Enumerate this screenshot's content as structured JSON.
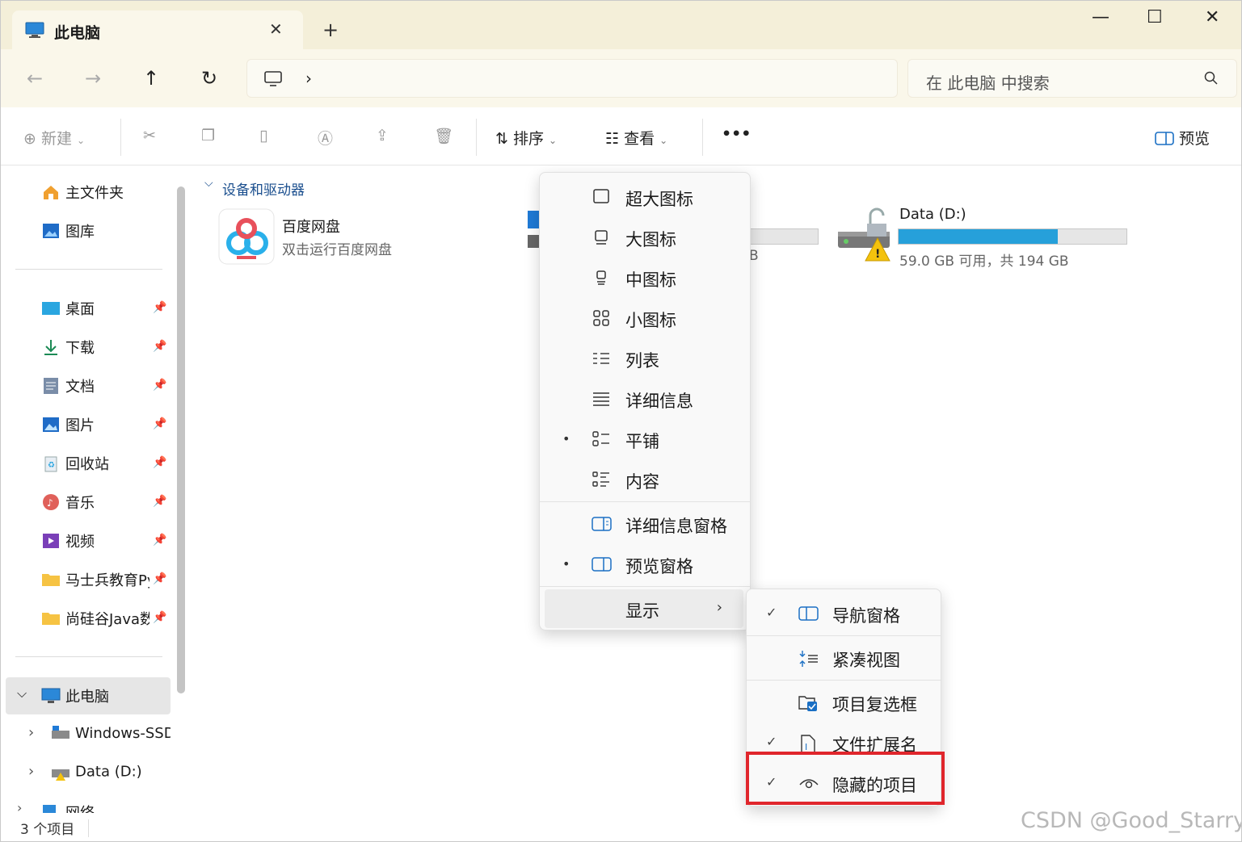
{
  "window": {
    "tab_title": "此电脑",
    "new_tab": "+",
    "close_tab": "✕",
    "minimize": "—",
    "maximize": "☐",
    "close": "✕"
  },
  "address": {
    "separator": "›",
    "search_placeholder": "在 此电脑 中搜索"
  },
  "toolbar": {
    "new": "新建",
    "sort": "排序",
    "view": "查看",
    "more": "•••",
    "preview": "预览"
  },
  "nav": {
    "quick": [
      {
        "label": "主文件夹",
        "icon": "home-icon"
      },
      {
        "label": "图库",
        "icon": "gallery-icon"
      }
    ],
    "pinned": [
      {
        "label": "桌面",
        "icon": "desktop-folder-icon"
      },
      {
        "label": "下载",
        "icon": "download-icon"
      },
      {
        "label": "文档",
        "icon": "document-icon"
      },
      {
        "label": "图片",
        "icon": "pictures-icon"
      },
      {
        "label": "回收站",
        "icon": "recycle-bin-icon"
      },
      {
        "label": "音乐",
        "icon": "music-icon"
      },
      {
        "label": "视频",
        "icon": "video-icon"
      },
      {
        "label": "马士兵教育Py",
        "icon": "folder-icon"
      },
      {
        "label": "尚硅谷Java数",
        "icon": "folder-icon"
      }
    ],
    "this_pc": "此电脑",
    "drives": [
      {
        "label": "Windows-SSD",
        "icon": "ssd-drive-icon"
      },
      {
        "label": "Data (D:)",
        "icon": "data-drive-icon"
      }
    ],
    "network": "网络"
  },
  "content": {
    "group_label": "设备和驱动器",
    "baidu": {
      "title": "百度网盘",
      "subtitle": "双击运行百度网盘"
    },
    "drive_c_partial": "B",
    "drive_d": {
      "title": "Data (D:)",
      "subtitle": "59.0 GB 可用，共 194 GB",
      "used_fraction": 0.7
    }
  },
  "view_menu": {
    "items": [
      {
        "label": "超大图标",
        "icon": "extra-large-icons-icon",
        "selected": false
      },
      {
        "label": "大图标",
        "icon": "large-icons-icon",
        "selected": false
      },
      {
        "label": "中图标",
        "icon": "medium-icons-icon",
        "selected": false
      },
      {
        "label": "小图标",
        "icon": "small-icons-icon",
        "selected": false
      },
      {
        "label": "列表",
        "icon": "list-icon",
        "selected": false
      },
      {
        "label": "详细信息",
        "icon": "details-icon",
        "selected": false
      },
      {
        "label": "平铺",
        "icon": "tiles-icon",
        "selected": true
      },
      {
        "label": "内容",
        "icon": "content-icon",
        "selected": false
      }
    ],
    "panes": [
      {
        "label": "详细信息窗格",
        "icon": "details-pane-icon",
        "selected": false
      },
      {
        "label": "预览窗格",
        "icon": "preview-pane-icon",
        "selected": true
      }
    ],
    "show": "显示"
  },
  "show_submenu": [
    {
      "label": "导航窗格",
      "icon": "navigation-pane-icon",
      "checked": true
    },
    {
      "label": "紧凑视图",
      "icon": "compact-view-icon",
      "checked": false
    },
    {
      "label": "项目复选框",
      "icon": "item-checkbox-icon",
      "checked": false
    },
    {
      "label": "文件扩展名",
      "icon": "file-extension-icon",
      "checked": true
    },
    {
      "label": "隐藏的项目",
      "icon": "hidden-items-icon",
      "checked": true
    }
  ],
  "status": {
    "count": "3 个项目"
  },
  "watermark": "CSDN @Good_Starry",
  "colors": {
    "accent": "#26a0da",
    "highlight_box": "#e0262c",
    "titlebar": "#f4efd9"
  }
}
